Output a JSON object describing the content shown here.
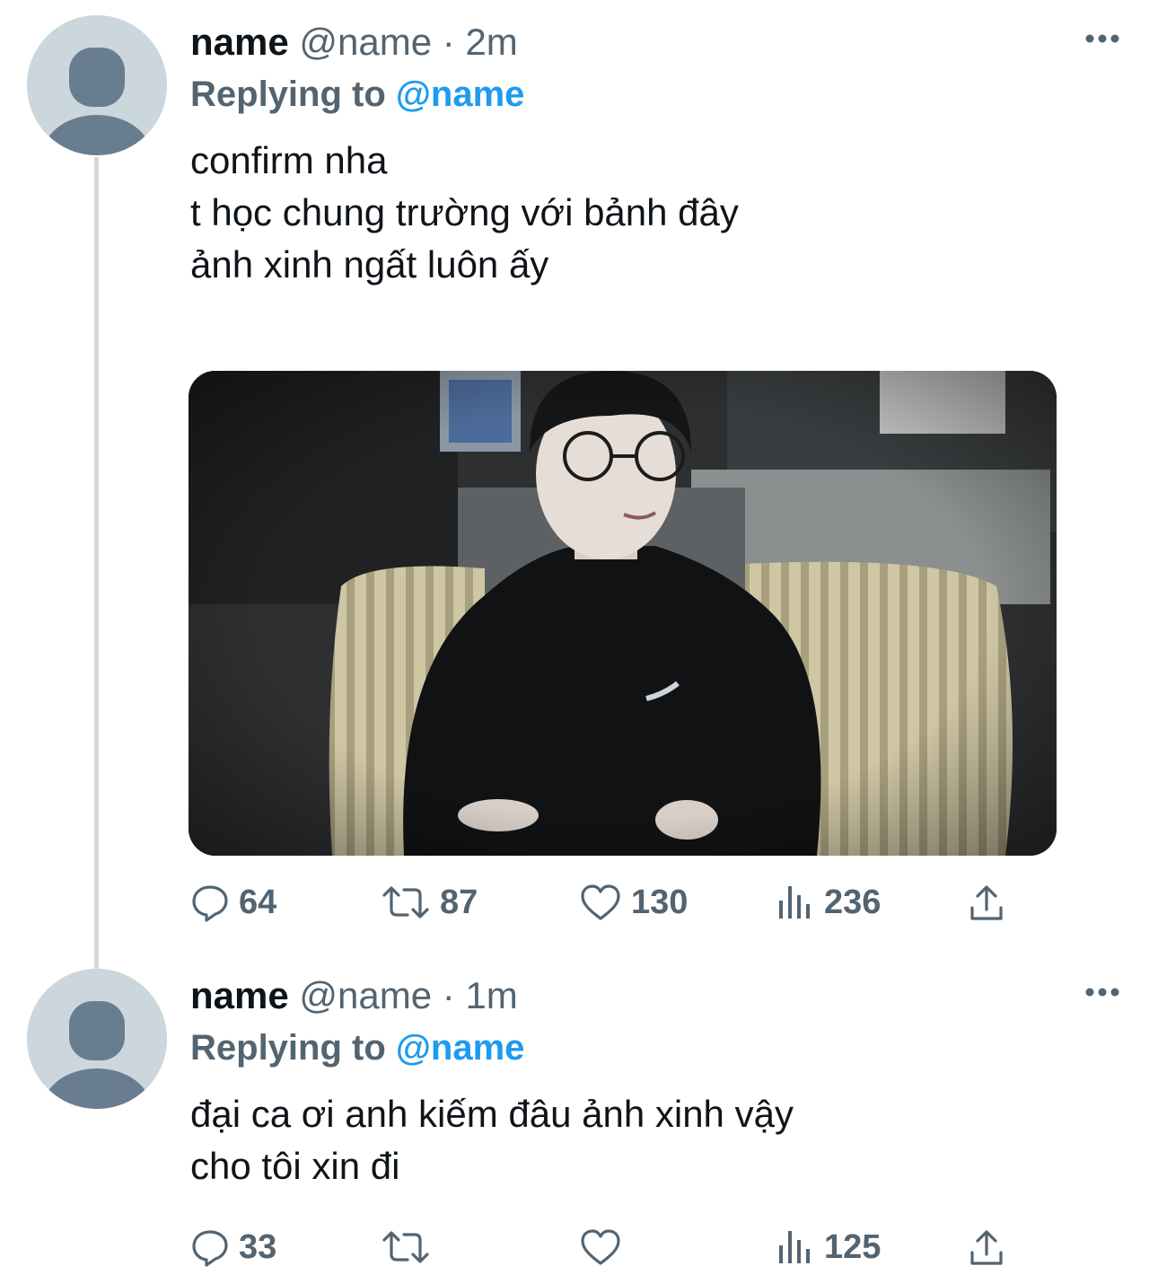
{
  "tweets": [
    {
      "name": "name",
      "handle": "@name",
      "separator": "·",
      "time": "2m",
      "replying_prefix": "Replying to",
      "replying_handle": "@name",
      "lines": [
        "confirm nha",
        "t học chung trường với bảnh đây",
        "ảnh xinh ngất luôn ấy"
      ],
      "has_media": true,
      "stats": {
        "replies": "64",
        "retweets": "87",
        "likes": "130",
        "views": "236"
      }
    },
    {
      "name": "name",
      "handle": "@name",
      "separator": "·",
      "time": "1m",
      "replying_prefix": "Replying to",
      "replying_handle": "@name",
      "lines": [
        "đại ca ơi anh kiếm đâu ảnh xinh vậy",
        "cho tôi xin đi"
      ],
      "has_media": false,
      "stats": {
        "replies": "33",
        "retweets": "",
        "likes": "",
        "views": "125"
      }
    }
  ],
  "icons": {
    "avatar": "default-avatar-icon",
    "more": "more-dots-icon",
    "reply": "reply-bubble-icon",
    "retweet": "retweet-icon",
    "like": "heart-icon",
    "views": "views-bars-icon",
    "share": "share-icon"
  },
  "colors": {
    "text": "#0f1419",
    "secondary": "#536471",
    "link": "#1d9bf0",
    "thread_line": "#cfd9de",
    "avatar_bg": "#ccd6dd",
    "avatar_fg": "#687d8f"
  }
}
